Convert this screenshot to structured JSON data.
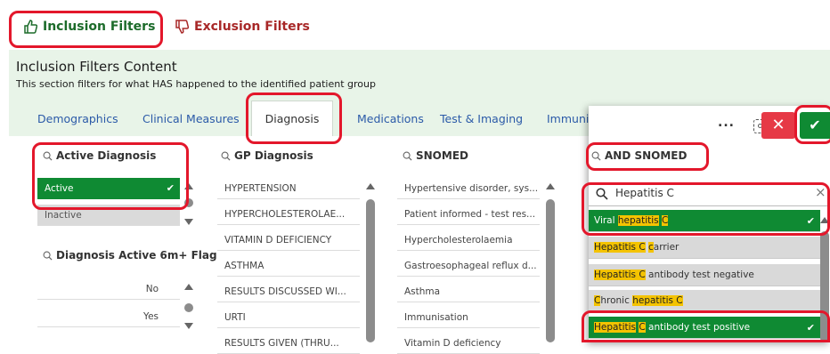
{
  "filter_tabs": {
    "inclusion": "Inclusion Filters",
    "exclusion": "Exclusion Filters"
  },
  "section": {
    "title": "Inclusion Filters Content",
    "description": "This section filters for what HAS happened to the identified patient group"
  },
  "subtabs": [
    "Demographics",
    "Clinical Measures",
    "Diagnosis",
    "Medications",
    "Test & Imaging",
    "Immuni"
  ],
  "columns": {
    "active_diagnosis": {
      "title": "Active Diagnosis",
      "items": [
        {
          "label": "Active",
          "selected": true
        },
        {
          "label": "Inactive",
          "selected": false
        }
      ]
    },
    "active_6m_flag": {
      "title": "Diagnosis Active 6m+ Flag",
      "items": [
        "No",
        "Yes"
      ]
    },
    "gp_diagnosis": {
      "title": "GP Diagnosis",
      "items": [
        "HYPERTENSION",
        "HYPERCHOLESTEROLAE...",
        "VITAMIN D DEFICIENCY",
        "ASTHMA",
        "RESULTS DISCUSSED WI...",
        "URTI",
        "RESULTS GIVEN (THRU..."
      ]
    },
    "snomed": {
      "title": "SNOMED",
      "items": [
        "Hypertensive disorder, sys...",
        "Patient informed - test res...",
        "Hypercholesterolaemia",
        "Gastroesophageal reflux d...",
        "Asthma",
        "Immunisation",
        "Vitamin D deficiency"
      ]
    }
  },
  "popup": {
    "more": "...",
    "title": "AND SNOMED",
    "search_value": "Hepatitis C",
    "clear": "×",
    "results": [
      {
        "pre": "Viral ",
        "hl": "hepatitis",
        "mid": " ",
        "hl2": "C",
        "post": "",
        "state": "selected"
      },
      {
        "pre": "",
        "hl": "Hepatitis C",
        "mid": " ",
        "hl2": "c",
        "post": "arrier",
        "state": "grey"
      },
      {
        "pre": "",
        "hl": "Hepatitis C",
        "mid": "",
        "hl2": "",
        "post": " antibody test negative",
        "state": "grey"
      },
      {
        "pre": "",
        "hl": "C",
        "mid": "hronic ",
        "hl2": "hepatitis C",
        "post": "",
        "state": "grey"
      },
      {
        "pre": "",
        "hl": "Hepatitis",
        "mid": " ",
        "hl2": "C",
        "post": " antibody test positive",
        "state": "selected"
      }
    ]
  },
  "colors": {
    "accent_green": "#0f8a33",
    "highlight_red": "#e3172b",
    "exclusion_red": "#a82828",
    "link_blue": "#2b5aa8",
    "match_yellow": "#f4c300"
  }
}
